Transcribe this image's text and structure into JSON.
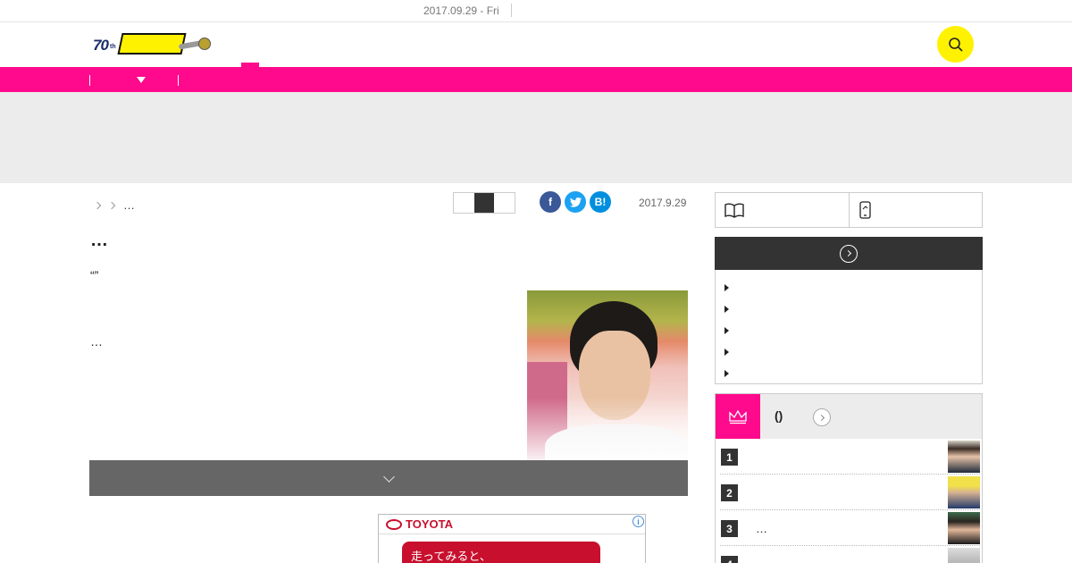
{
  "topbar": {
    "date": "2017.09.29 - Fri"
  },
  "header": {
    "logo_text": "70th デイリー"
  },
  "breadcrumb": {
    "current": "…"
  },
  "article": {
    "date": "2017.9.29",
    "title": "…",
    "quote": "“”",
    "body": "…"
  },
  "share": {
    "facebook": "f",
    "twitter": "t",
    "hatena": "B!"
  },
  "ad": {
    "brand": "TOYOTA",
    "info": "i",
    "cta": "走ってみると、"
  },
  "ranking": {
    "title": "()",
    "items": [
      {
        "rank": "1",
        "text": ""
      },
      {
        "rank": "2",
        "text": ""
      },
      {
        "rank": "3",
        "text": "…"
      },
      {
        "rank": "4",
        "text": ""
      }
    ]
  },
  "colors": {
    "accent": "#ff0a8c",
    "search": "#fff200",
    "dark": "#333333"
  }
}
